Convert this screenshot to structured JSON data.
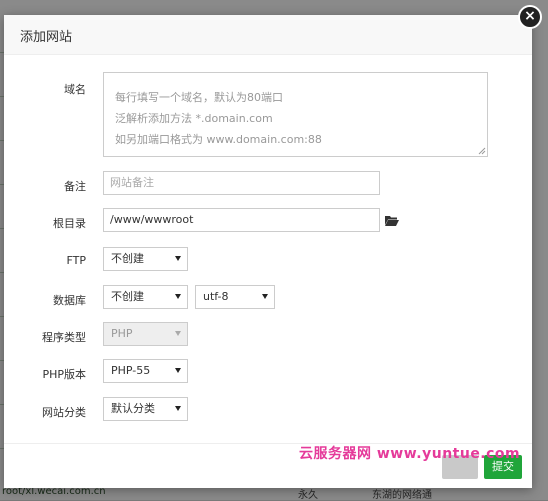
{
  "background": {
    "url_text": "root/xl.wecai.com.cn",
    "status_text": "永久",
    "note_text": "东湖的网络通"
  },
  "dialog": {
    "title": "添加网站",
    "close_symbol": "×"
  },
  "form": {
    "domain": {
      "label": "域名",
      "placeholder_lines": [
        "每行填写一个域名，默认为80端口",
        "泛解析添加方法 *.domain.com",
        "如另加端口格式为 www.domain.com:88"
      ]
    },
    "remark": {
      "label": "备注",
      "placeholder": "网站备注"
    },
    "root": {
      "label": "根目录",
      "value": "/www/wwwroot"
    },
    "ftp": {
      "label": "FTP",
      "value": "不创建"
    },
    "database": {
      "label": "数据库",
      "value": "不创建",
      "charset": "utf-8"
    },
    "program_type": {
      "label": "程序类型",
      "value": "PHP"
    },
    "php_version": {
      "label": "PHP版本",
      "value": "PHP-55"
    },
    "site_category": {
      "label": "网站分类",
      "value": "默认分类"
    }
  },
  "footer": {
    "submit_label": "提交"
  },
  "watermark": "云服务器网 www.yuntue.com",
  "colors": {
    "accent": "#20a53a",
    "watermark": "#e53a9a"
  }
}
